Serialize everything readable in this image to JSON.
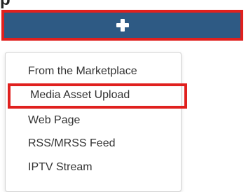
{
  "header": {
    "partial_glyph": "p"
  },
  "add_button": {
    "icon": "plus-icon",
    "background_color": "#2e5a84",
    "highlight_color": "#e0201e"
  },
  "dropdown": {
    "items": [
      {
        "label": "From the Marketplace"
      },
      {
        "label": "Media Asset Upload",
        "highlighted": true
      },
      {
        "label": "Web Page"
      },
      {
        "label": "RSS/MRSS Feed"
      },
      {
        "label": "IPTV Stream"
      }
    ]
  }
}
